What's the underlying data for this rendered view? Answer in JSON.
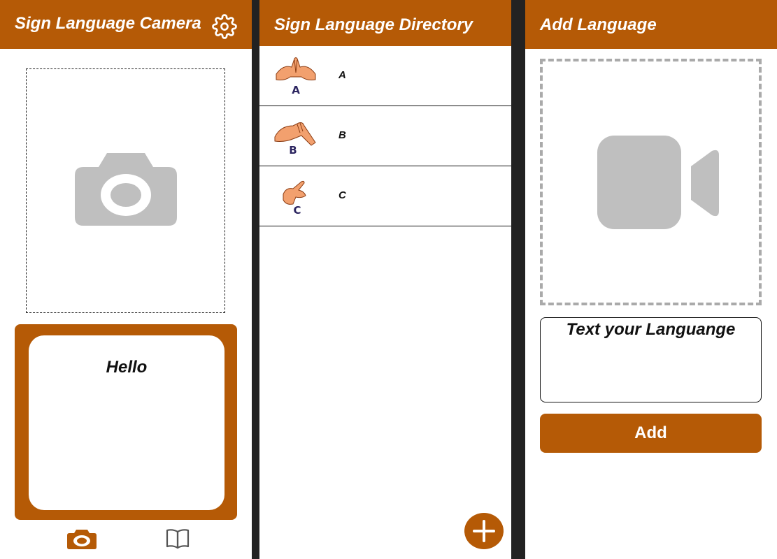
{
  "colors": {
    "brand": "#b55a06",
    "placeholder_gray": "#bfbfbf",
    "background": "#ffffff",
    "divider": "#222222"
  },
  "camera_screen": {
    "title": "Sign Language Camera",
    "settings_icon": "gear-icon",
    "preview_icon": "camera-icon",
    "output_text": "Hello",
    "bottom_nav": [
      {
        "icon": "camera-icon",
        "active": true
      },
      {
        "icon": "book-icon",
        "active": false
      }
    ]
  },
  "directory_screen": {
    "title": "Sign Language Directory",
    "items": [
      {
        "label": "A",
        "image_letter": "A"
      },
      {
        "label": "B",
        "image_letter": "B"
      },
      {
        "label": "C",
        "image_letter": "C"
      }
    ],
    "fab_icon": "plus-icon"
  },
  "add_screen": {
    "title": "Add Language",
    "video_icon": "video-camera-icon",
    "text_placeholder": "Text your Languange",
    "add_label": "Add"
  }
}
